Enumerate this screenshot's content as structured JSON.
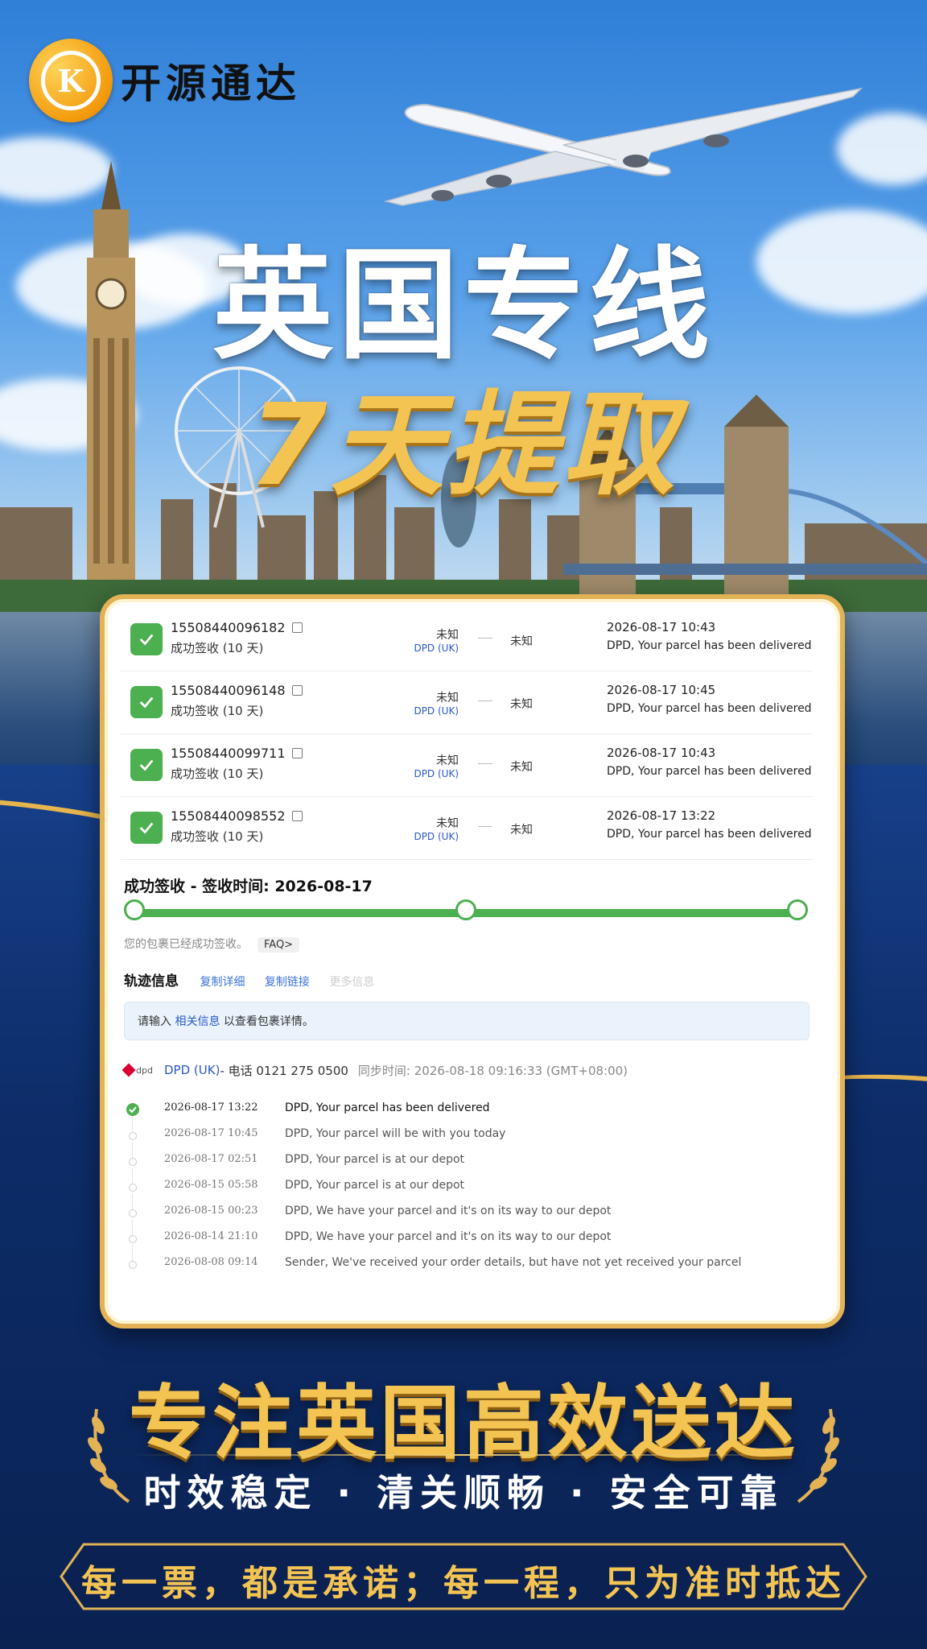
{
  "brand": {
    "logo_letter": "K",
    "name": "开源通达"
  },
  "headline": {
    "line1": "英国专线",
    "line2": "7天提取"
  },
  "shipments": [
    {
      "tracking": "15508440096182",
      "status": "成功签收 (10 天)",
      "origin": "未知",
      "carrier": "DPD (UK)",
      "destination": "未知",
      "datetime": "2026-08-17 10:43",
      "message": "DPD, Your parcel has been delivered"
    },
    {
      "tracking": "15508440096148",
      "status": "成功签收 (10 天)",
      "origin": "未知",
      "carrier": "DPD (UK)",
      "destination": "未知",
      "datetime": "2026-08-17 10:45",
      "message": "DPD, Your parcel has been delivered"
    },
    {
      "tracking": "15508440099711",
      "status": "成功签收 (10 天)",
      "origin": "未知",
      "carrier": "DPD (UK)",
      "destination": "未知",
      "datetime": "2026-08-17 10:43",
      "message": "DPD, Your parcel has been delivered"
    },
    {
      "tracking": "15508440098552",
      "status": "成功签收 (10 天)",
      "origin": "未知",
      "carrier": "DPD (UK)",
      "destination": "未知",
      "datetime": "2026-08-17 13:22",
      "message": "DPD, Your parcel has been delivered"
    }
  ],
  "delivery": {
    "title": "成功签收 - 签收时间: 2026-08-17",
    "progress": 1.0,
    "hint": "您的包裹已经成功签收。",
    "faq": "FAQ>"
  },
  "tabs": {
    "main": "轨迹信息",
    "copy_detail": "复制详细",
    "copy_link": "复制链接",
    "more": "更多信息"
  },
  "notice": {
    "before": "请输入 ",
    "link": "相关信息",
    "after": " 以查看包裹详情。"
  },
  "carrier_info": {
    "logo_text": "dpd",
    "name": "DPD (UK)",
    "phone": " - 电话 0121 275 0500",
    "sync": "同步时间: 2026-08-18 09:16:33 (GMT+08:00)"
  },
  "events": [
    {
      "time": "2026-08-17 13:22",
      "text": "DPD, Your parcel has been delivered"
    },
    {
      "time": "2026-08-17 10:45",
      "text": "DPD, Your parcel will be with you today"
    },
    {
      "time": "2026-08-17 02:51",
      "text": "DPD, Your parcel is at our depot"
    },
    {
      "time": "2026-08-15 05:58",
      "text": "DPD, Your parcel is at our depot"
    },
    {
      "time": "2026-08-15 00:23",
      "text": "DPD, We have your parcel and it's on its way to our depot"
    },
    {
      "time": "2026-08-14 21:10",
      "text": "DPD, We have your parcel and it's on its way to our depot"
    },
    {
      "time": "2026-08-08 09:14",
      "text": "Sender, We've received your order details, but have not yet received your parcel"
    }
  ],
  "bottom": {
    "slogan": "专注英国高效送达",
    "features": "时效稳定 · 清关顺畅 · 安全可靠",
    "banner": "每一票，都是承诺；每一程，只为准时抵达"
  },
  "colors": {
    "gold": "#f4c453",
    "success": "#4caf50",
    "link": "#2a57c5",
    "navy": "#0d2c68"
  }
}
